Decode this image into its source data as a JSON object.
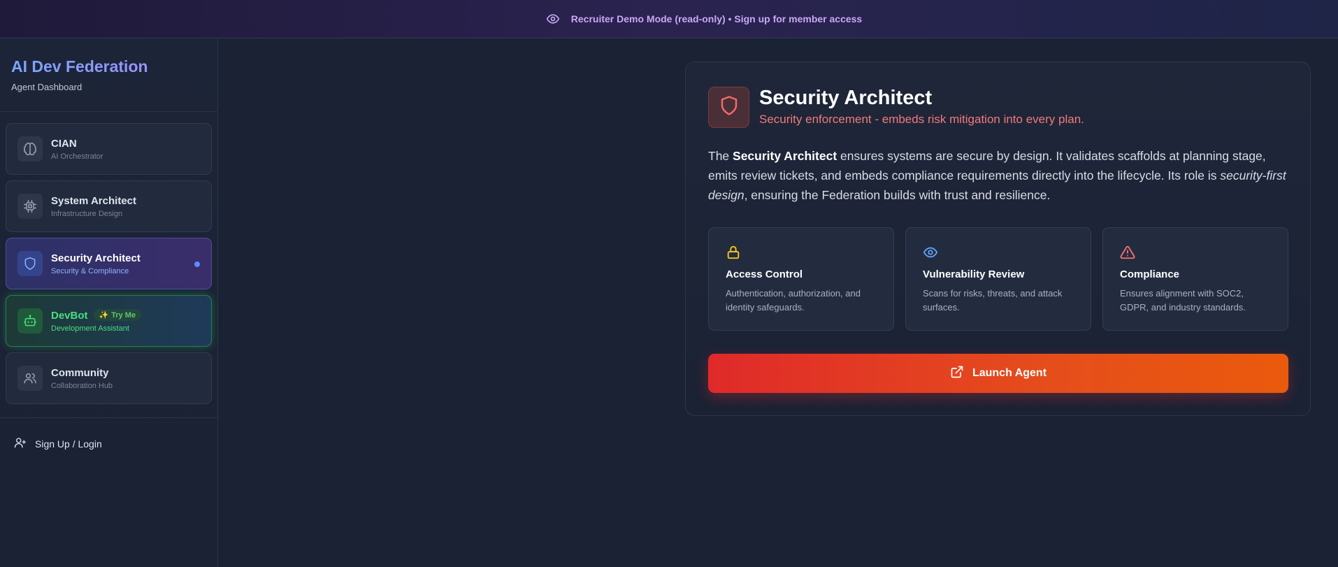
{
  "banner": {
    "text": "Recruiter Demo Mode (read-only) • Sign up for member access",
    "icon": "eye-icon"
  },
  "sidebar": {
    "title": "AI Dev Federation",
    "subtitle": "Agent Dashboard",
    "items": [
      {
        "label": "CIAN",
        "sublabel": "AI Orchestrator",
        "icon": "brain-icon"
      },
      {
        "label": "System Architect",
        "sublabel": "Infrastructure Design",
        "icon": "cpu-icon"
      },
      {
        "label": "Security Architect",
        "sublabel": "Security & Compliance",
        "icon": "shield-icon",
        "active": true
      },
      {
        "label": "DevBot",
        "sublabel": "Development Assistant",
        "badge": "Try Me",
        "icon": "bot-icon"
      },
      {
        "label": "Community",
        "sublabel": "Collaboration Hub",
        "icon": "users-icon"
      }
    ],
    "signup_label": "Sign Up / Login"
  },
  "agent": {
    "title": "Security Architect",
    "subtitle": "Security enforcement - embeds risk mitigation into every plan.",
    "description": {
      "intro": "The ",
      "name": "Security Architect",
      "body": " ensures systems are secure by design. It validates scaffolds at planning stage, emits review tickets, and embeds compliance requirements directly into the lifecycle. Its role is ",
      "emphasis": "security-first design",
      "outro": ", ensuring the Federation builds with trust and resilience."
    },
    "features": [
      {
        "title": "Access Control",
        "description": "Authentication, authorization, and identity safeguards.",
        "icon": "lock-icon",
        "color": "#facc15"
      },
      {
        "title": "Vulnerability Review",
        "description": "Scans for risks, threats, and attack surfaces.",
        "icon": "eye-icon",
        "color": "#60a5fa"
      },
      {
        "title": "Compliance",
        "description": "Ensures alignment with SOC2, GDPR, and industry standards.",
        "icon": "alert-triangle-icon",
        "color": "#f87171"
      }
    ],
    "launch_label": "Launch Agent"
  },
  "colors": {
    "accent_purple": "#c9a8f5",
    "accent_red": "#e02a2a",
    "accent_orange": "#ea5a0c",
    "devbot_green": "#4ade80",
    "active_dot": "#5b8cff"
  }
}
